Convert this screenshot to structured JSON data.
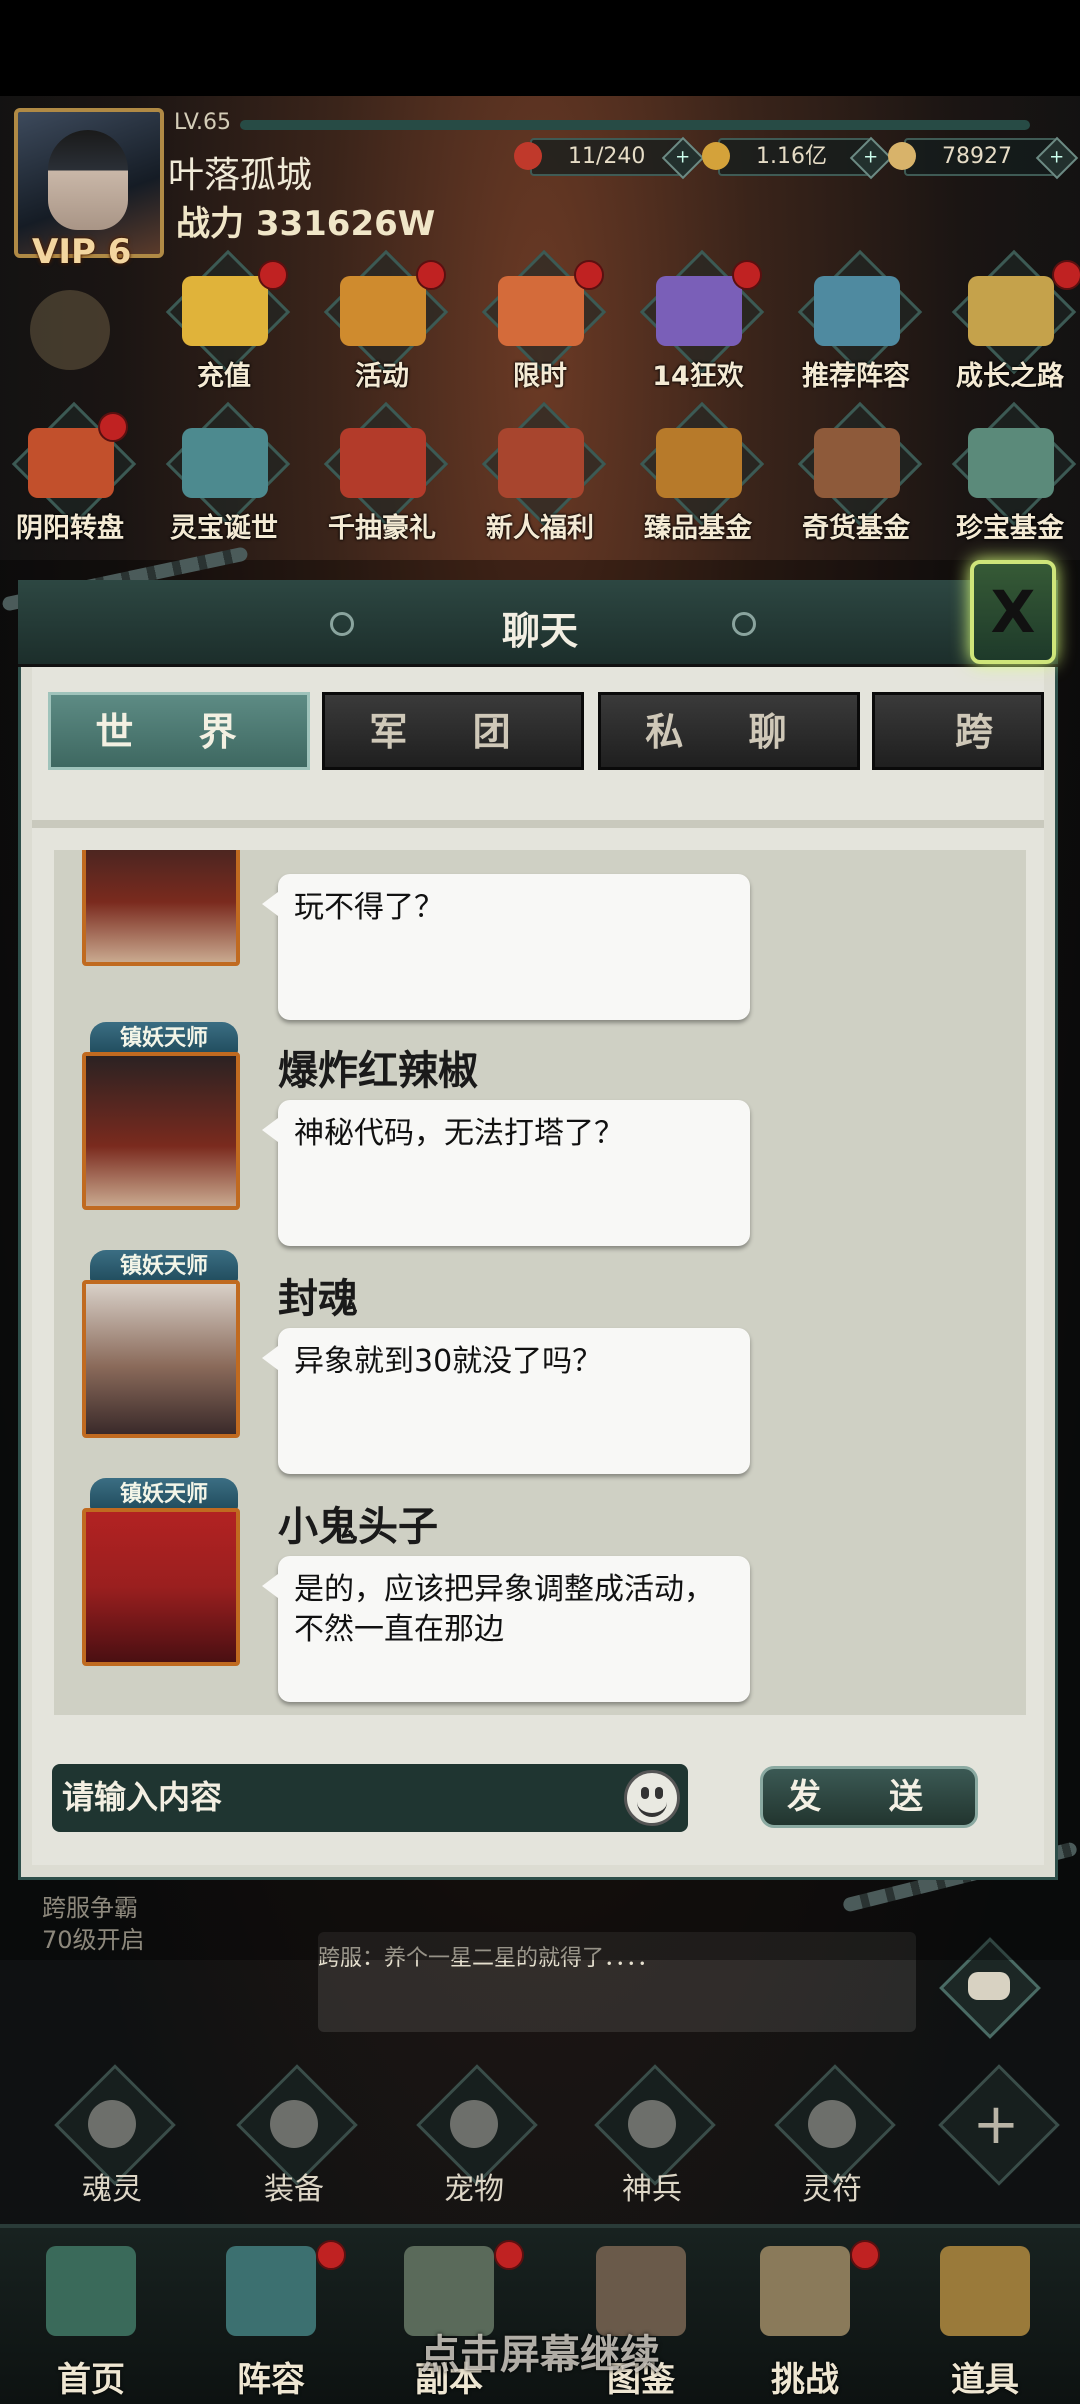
{
  "player": {
    "level": "LV.65",
    "name": "叶落孤城",
    "power": "战力 331626W",
    "vip": "VIP 6"
  },
  "resources": [
    {
      "value": "11/240",
      "icon": "stamina-icon",
      "color": "#c0392b"
    },
    {
      "value": "1.16亿",
      "icon": "gold-coin-icon",
      "color": "#d4a23a"
    },
    {
      "value": "78927",
      "icon": "ingot-icon",
      "color": "#d8b36a"
    }
  ],
  "activities_row1": [
    {
      "label": "充值",
      "color": "#e0b33a",
      "dot": true
    },
    {
      "label": "活动",
      "color": "#cf8b2e",
      "dot": true
    },
    {
      "label": "限时",
      "color": "#d46b3a",
      "dot": true
    },
    {
      "label": "14狂欢",
      "color": "#7a5fb8",
      "dot": true
    },
    {
      "label": "推荐阵容",
      "color": "#4f8aa0",
      "dot": false
    },
    {
      "label": "成长之路",
      "color": "#c5a24b",
      "dot": true
    }
  ],
  "activities_row2": [
    {
      "label": "阴阳转盘",
      "color": "#c2502c",
      "dot": true
    },
    {
      "label": "灵宝诞世",
      "color": "#4d8a8f",
      "dot": false
    },
    {
      "label": "千抽豪礼",
      "color": "#b33b2a",
      "dot": false
    },
    {
      "label": "新人福利",
      "color": "#a8452e",
      "dot": false
    },
    {
      "label": "臻品基金",
      "color": "#b77a2a",
      "dot": false
    },
    {
      "label": "奇货基金",
      "color": "#8e5a3a",
      "dot": false
    },
    {
      "label": "珍宝基金",
      "color": "#5b8a7a",
      "dot": false
    }
  ],
  "chat": {
    "title": "聊天",
    "close_label": "X",
    "tabs": [
      "世 界",
      "军 团",
      "私 聊",
      "跨 服"
    ],
    "messages": [
      {
        "badge": "",
        "name": "",
        "text": "玩不得了？",
        "portrait": "#7a2a1e"
      },
      {
        "badge": "镇妖天师",
        "name": "爆炸红辣椒",
        "text": "神秘代码，无法打塔了？",
        "portrait": "#7a2a1e"
      },
      {
        "badge": "镇妖天师",
        "name": "封魂",
        "text": "异象就到30就没了吗？",
        "portrait": "#8a6a5a"
      },
      {
        "badge": "镇妖天师",
        "name": "小鬼头子",
        "text": "是的，应该把异象调整成活动，不然一直在那边",
        "portrait": "#9a1f1f"
      }
    ],
    "input_placeholder": "请输入内容",
    "send_label": "发 送"
  },
  "cross_server": {
    "line1": "跨服争霸",
    "line2": "70级开启",
    "preview": "跨服：养个一星二星的就得了．．．．"
  },
  "skills": [
    "魂灵",
    "装备",
    "宠物",
    "神兵",
    "灵符"
  ],
  "nav": [
    {
      "label": "首页",
      "color": "#3a6a5a"
    },
    {
      "label": "阵容",
      "color": "#3c7070"
    },
    {
      "label": "副本",
      "color": "#5a6a5a"
    },
    {
      "label": "图鉴",
      "color": "#6a5a4a"
    },
    {
      "label": "挑战",
      "color": "#8a7a5a"
    },
    {
      "label": "道具",
      "color": "#9a7a3a"
    }
  ],
  "tap_hint": "点击屏幕继续"
}
